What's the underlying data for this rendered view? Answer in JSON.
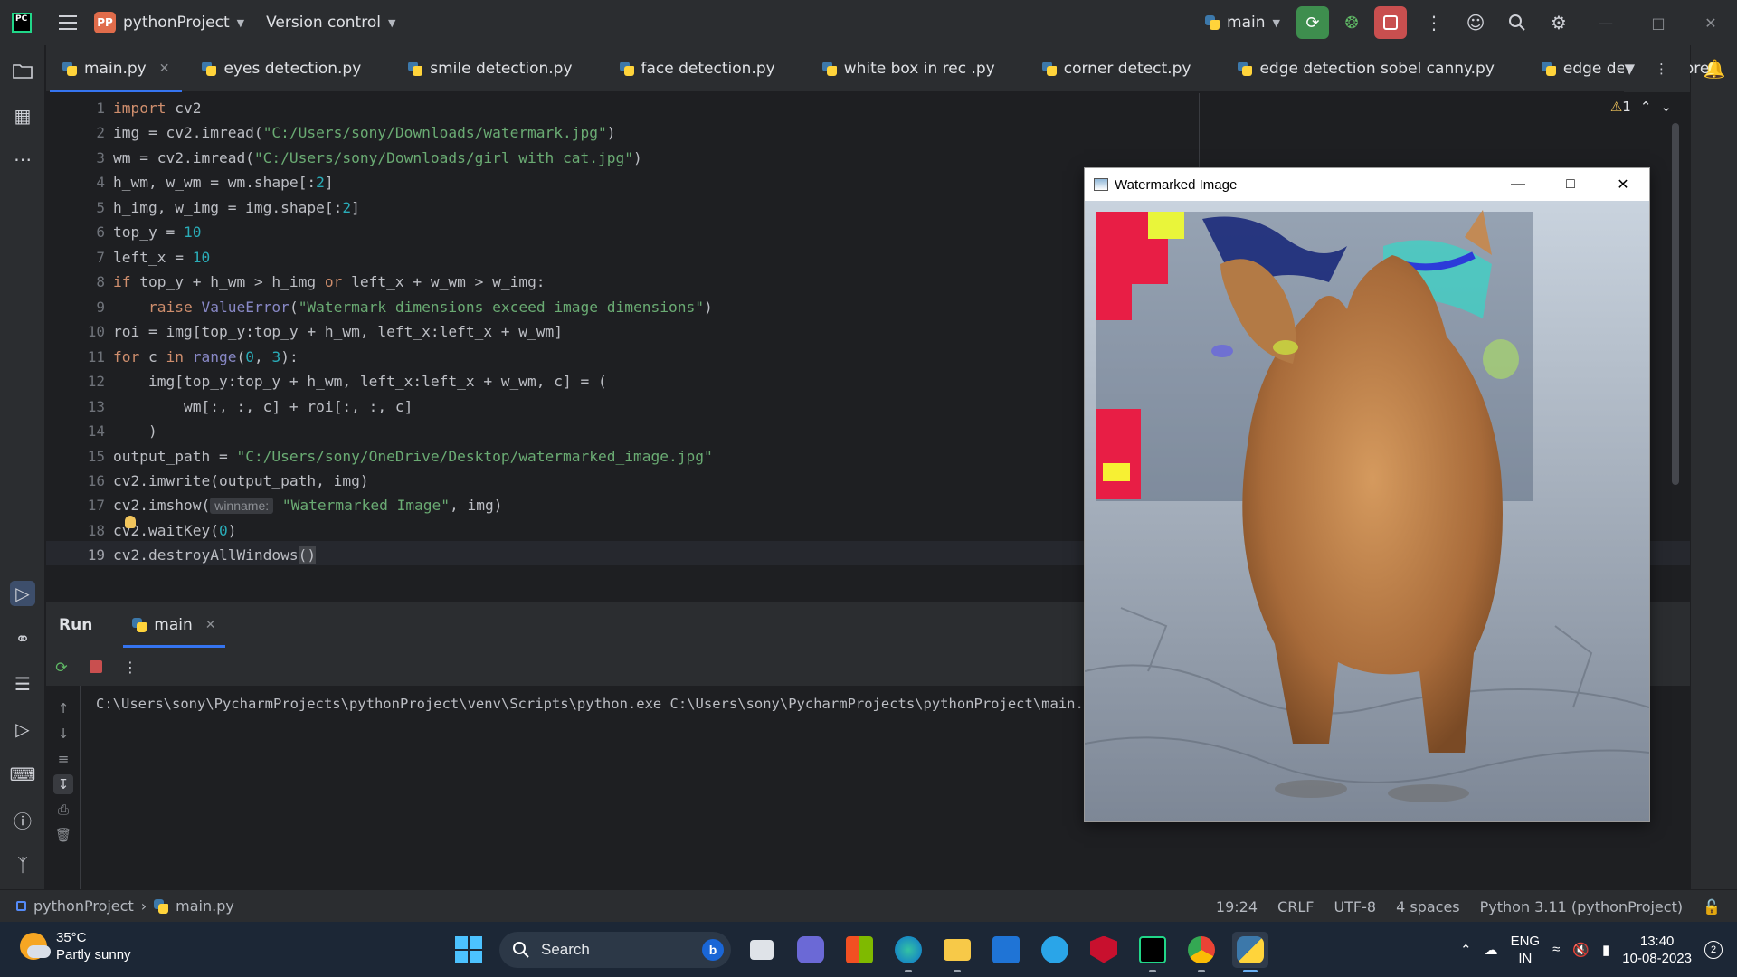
{
  "titlebar": {
    "logo": "PC",
    "project_badge": "PP",
    "project_name": "pythonProject",
    "version_control": "Version control",
    "branch": "main"
  },
  "tabs": [
    {
      "label": "main.py",
      "active": true
    },
    {
      "label": "eyes detection.py"
    },
    {
      "label": "smile detection.py"
    },
    {
      "label": "face detection.py"
    },
    {
      "label": "white box in rec .py"
    },
    {
      "label": "corner detect.py"
    },
    {
      "label": "edge detection sobel canny.py"
    },
    {
      "label": "edge detection pre"
    }
  ],
  "editor": {
    "warning_count": "1",
    "line_numbers": [
      "1",
      "2",
      "3",
      "4",
      "5",
      "6",
      "7",
      "8",
      "9",
      "10",
      "11",
      "12",
      "13",
      "14",
      "15",
      "16",
      "17",
      "18",
      "19"
    ],
    "current_line": 19,
    "code": {
      "l1_kw": "import",
      "l1_rest": " cv2",
      "l2_a": "img = cv2.imread(",
      "l2_s": "\"C:/Users/sony/Downloads/watermark.jpg\"",
      "l2_b": ")",
      "l3_a": "wm = cv2.imread(",
      "l3_s": "\"C:/Users/sony/Downloads/girl with cat.jpg\"",
      "l3_b": ")",
      "l4_a": "h_wm, w_wm = wm.shape[:",
      "l4_n": "2",
      "l4_b": "]",
      "l5_a": "h_img, w_img = img.shape[:",
      "l5_n": "2",
      "l5_b": "]",
      "l6_a": "top_y = ",
      "l6_n": "10",
      "l7_a": "left_x = ",
      "l7_n": "10",
      "l8_kw": "if",
      "l8_a": " top_y + h_wm > h_img ",
      "l8_kw2": "or",
      "l8_b": " left_x + w_wm > w_img:",
      "l9_kw": "raise",
      "l9_bi": "ValueError",
      "l9_a": "(",
      "l9_s": "\"Watermark dimensions exceed image dimensions\"",
      "l9_b": ")",
      "l10": "roi = img[top_y:top_y + h_wm, left_x:left_x + w_wm]",
      "l11_kw": "for",
      "l11_a": " c ",
      "l11_kw2": "in",
      "l11_bi": "range",
      "l11_b": "(",
      "l11_n1": "0",
      "l11_c": ", ",
      "l11_n2": "3",
      "l11_d": "):",
      "l12": "img[top_y:top_y + h_wm, left_x:left_x + w_wm, c] = (",
      "l13": "wm[:, :, c] + roi[:, :, c]",
      "l14": ")",
      "l15_a": "output_path = ",
      "l15_s": "\"C:/Users/sony/OneDrive/Desktop/watermarked_image.jpg\"",
      "l16": "cv2.imwrite(output_path, img)",
      "l17_a": "cv2.imshow(",
      "l17_hint": "winname:",
      "l17_s": "\"Watermarked Image\"",
      "l17_b": ", img)",
      "l18_a": "cv2.waitKey(",
      "l18_n": "0",
      "l18_b": ")",
      "l19_a": "cv2.destroyAllWindows",
      "l19_p": "()"
    }
  },
  "run": {
    "title": "Run",
    "tab": "main",
    "console_line": "C:\\Users\\sony\\PycharmProjects\\pythonProject\\venv\\Scripts\\python.exe C:\\Users\\sony\\PycharmProjects\\pythonProject\\main.py"
  },
  "cv_window": {
    "title": "Watermarked Image"
  },
  "statusbar": {
    "project": "pythonProject",
    "file": "main.py",
    "position": "19:24",
    "line_sep": "CRLF",
    "encoding": "UTF-8",
    "indent": "4 spaces",
    "interpreter": "Python 3.11 (pythonProject)"
  },
  "taskbar": {
    "temperature": "35°C",
    "weather": "Partly sunny",
    "search": "Search",
    "lang_top": "ENG",
    "lang_bottom": "IN",
    "time": "13:40",
    "date": "10-08-2023",
    "notifications": "2"
  },
  "colors": {
    "accent": "#3574f0",
    "run_green": "#3e8e4e",
    "stop_red": "#c94f4f",
    "editor_bg": "#1e1f22",
    "panel_bg": "#2b2d30"
  }
}
